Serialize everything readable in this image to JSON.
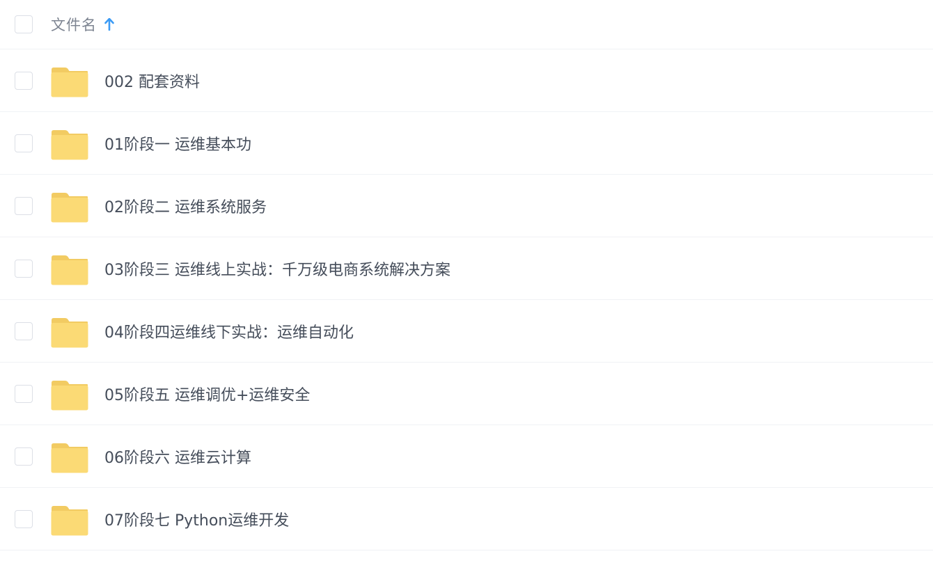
{
  "header": {
    "name_label": "文件名",
    "sort_icon": "arrow-up-icon",
    "sort_color": "#3b9bf5"
  },
  "folder_color": "#fbda75",
  "folder_tab_color": "#f2cb62",
  "files": [
    {
      "name": "002 配套资料",
      "icon": "folder-icon"
    },
    {
      "name": "01阶段一 运维基本功",
      "icon": "folder-icon"
    },
    {
      "name": "02阶段二 运维系统服务",
      "icon": "folder-icon"
    },
    {
      "name": "03阶段三 运维线上实战：千万级电商系统解决方案",
      "icon": "folder-icon"
    },
    {
      "name": "04阶段四运维线下实战：运维自动化",
      "icon": "folder-icon"
    },
    {
      "name": "05阶段五 运维调优+运维安全",
      "icon": "folder-icon"
    },
    {
      "name": "06阶段六 运维云计算",
      "icon": "folder-icon"
    },
    {
      "name": "07阶段七 Python运维开发",
      "icon": "folder-icon"
    }
  ]
}
